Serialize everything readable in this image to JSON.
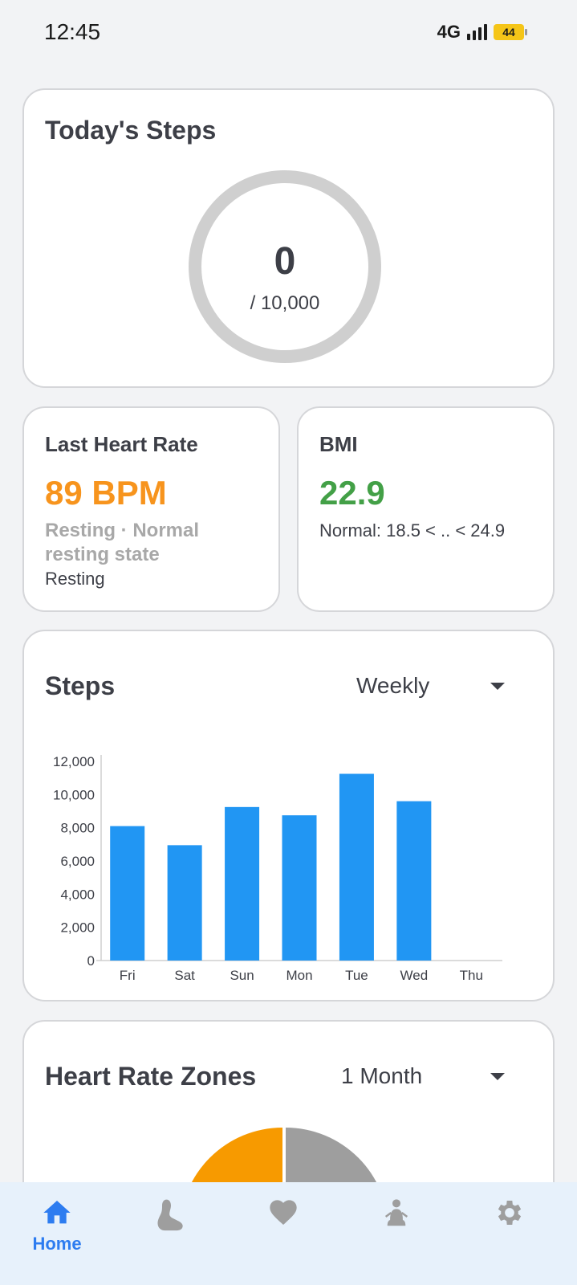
{
  "status": {
    "time": "12:45",
    "network": "4G",
    "battery": "44"
  },
  "steps_today": {
    "title": "Today's Steps",
    "value": "0",
    "goal": "/ 10,000",
    "progress": 0
  },
  "heart": {
    "title": "Last Heart Rate",
    "value": "89 BPM",
    "status": "Resting · Normal resting state",
    "sub": "Resting",
    "color": "#f7941d"
  },
  "bmi": {
    "title": "BMI",
    "value": "22.9",
    "range": "Normal: 18.5 < .. < 24.9",
    "color": "#43a047"
  },
  "steps_chart": {
    "title": "Steps",
    "period": "Weekly"
  },
  "chart_data": {
    "type": "bar",
    "categories": [
      "Fri",
      "Sat",
      "Sun",
      "Mon",
      "Tue",
      "Wed",
      "Thu"
    ],
    "values": [
      8100,
      6950,
      9250,
      8750,
      11250,
      9600,
      0
    ],
    "ylim": [
      0,
      12000
    ],
    "yticks": [
      "0",
      "2,000",
      "4,000",
      "6,000",
      "8,000",
      "10,000",
      "12,000"
    ],
    "bar_color": "#2196f3",
    "grid": false
  },
  "zones": {
    "title": "Heart Rate Zones",
    "period": "1 Month",
    "colors": [
      "#f79a00",
      "#9e9e9e"
    ]
  },
  "nav": {
    "items": [
      {
        "label": "Home",
        "icon": "home-icon",
        "active": true
      },
      {
        "label": "",
        "icon": "footprint-icon"
      },
      {
        "label": "",
        "icon": "heart-icon"
      },
      {
        "label": "",
        "icon": "meditation-icon"
      },
      {
        "label": "",
        "icon": "gear-icon"
      }
    ]
  }
}
